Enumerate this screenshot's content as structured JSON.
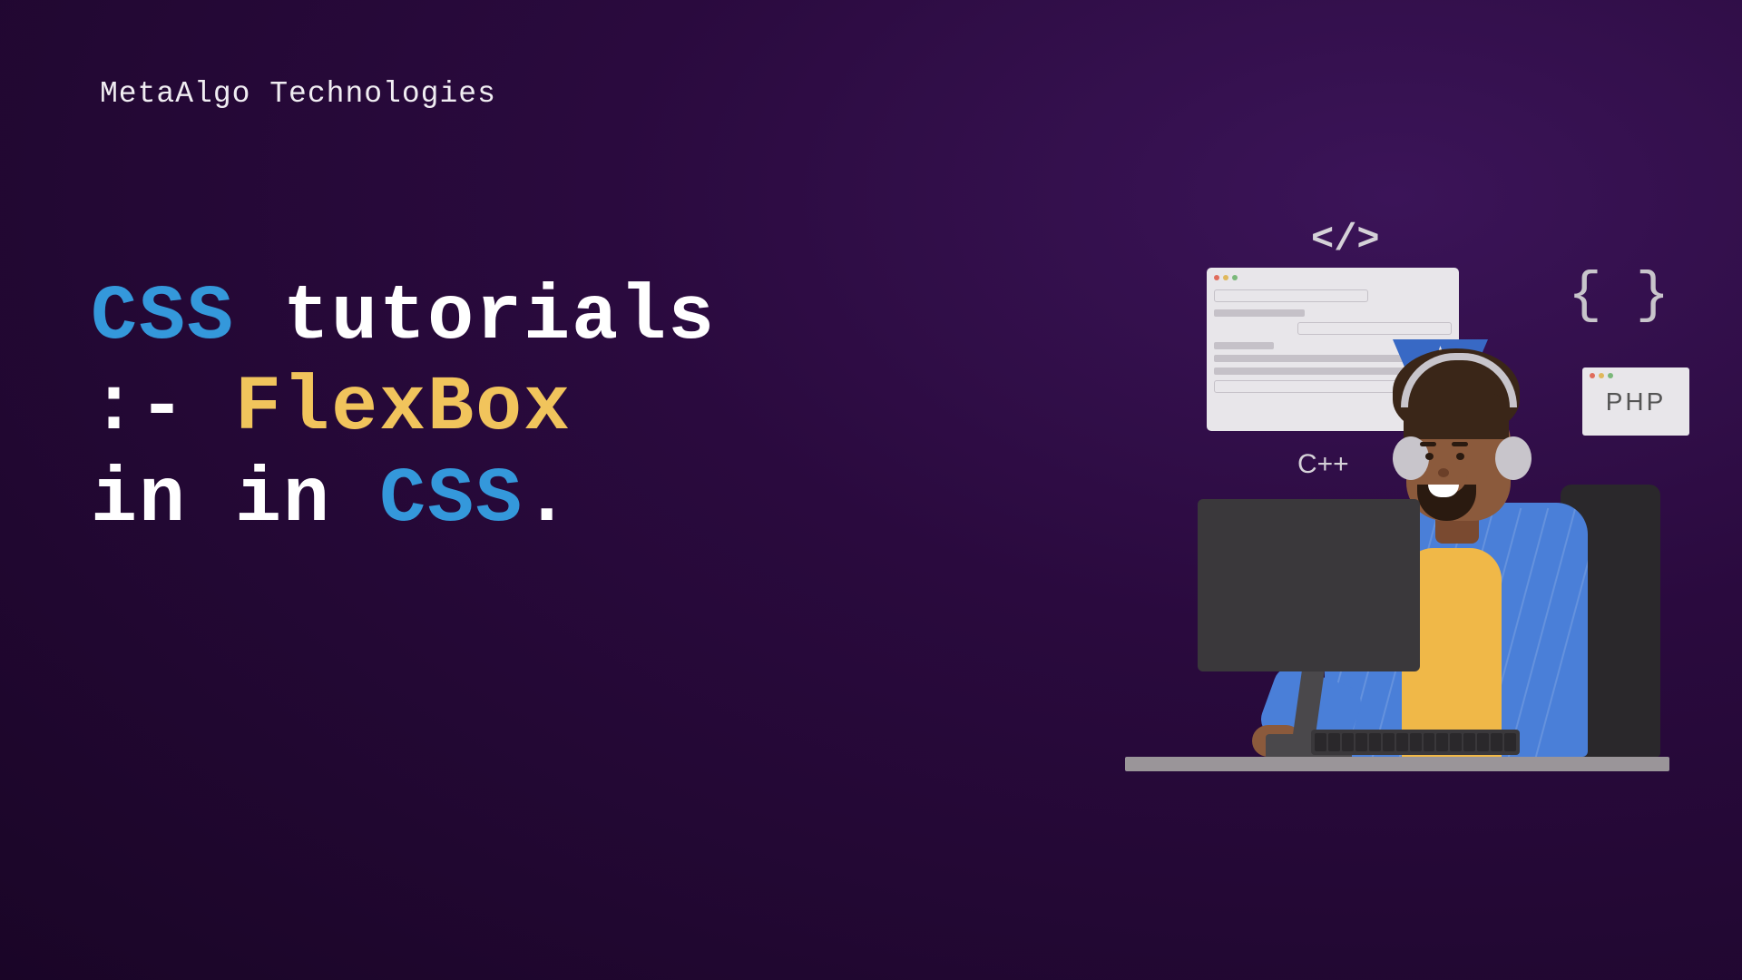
{
  "brand": "MetaAlgo Technologies",
  "title": {
    "word1": "CSS",
    "word2": "tutorials",
    "word3": ":-",
    "word4": "FlexBox",
    "word5": "in",
    "word6": "in",
    "word7": "CSS",
    "word8": "."
  },
  "illustration": {
    "code_tag": "</>",
    "brace": "{ }",
    "cpp": "C++",
    "php": "PHP"
  },
  "colors": {
    "blue": "#3498db",
    "white": "#ffffff",
    "yellow": "#f1c45c"
  }
}
